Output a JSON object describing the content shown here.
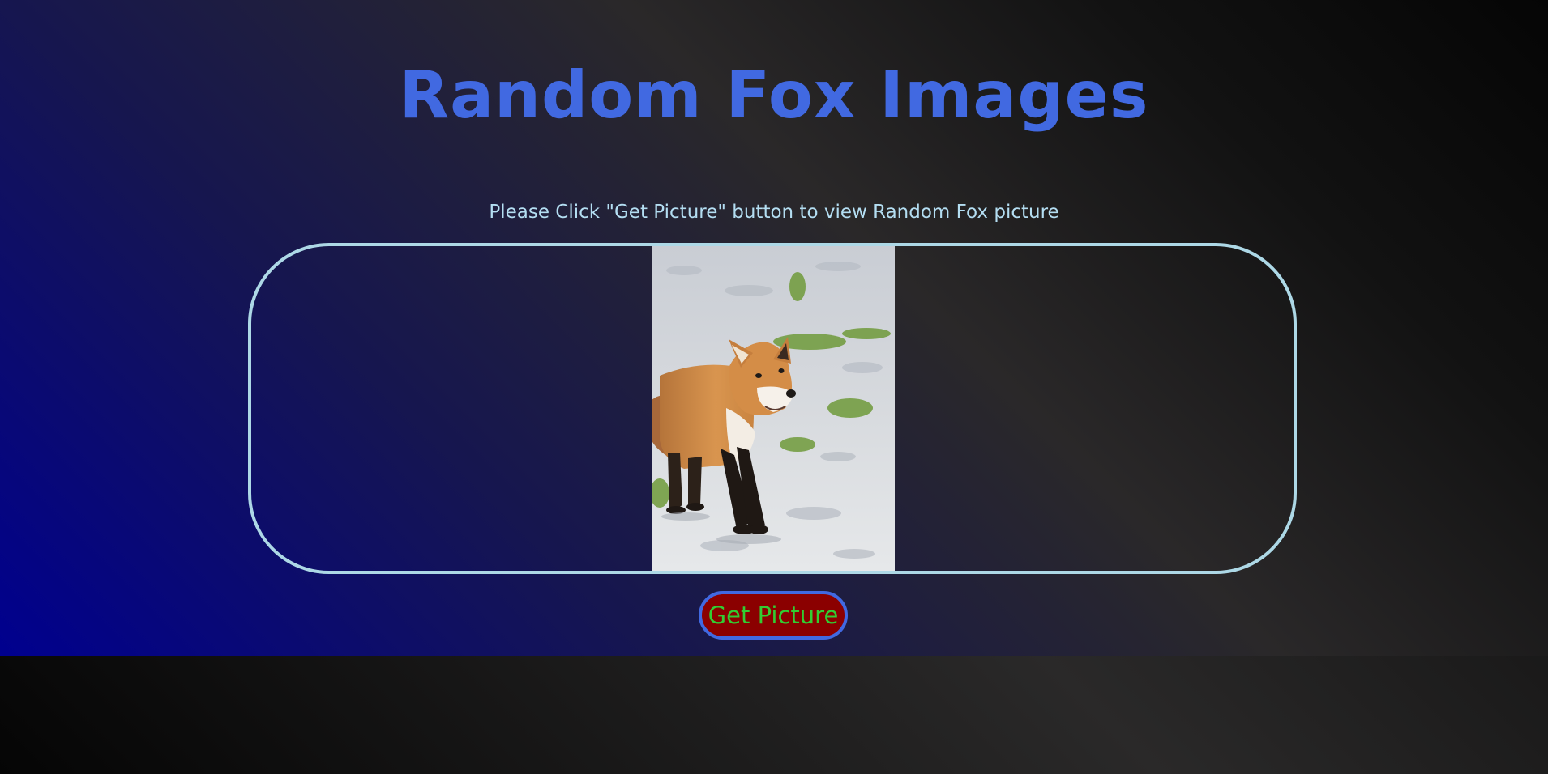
{
  "header": {
    "title": "Random Fox Images"
  },
  "main": {
    "instruction": "Please Click \"Get Picture\" button to view Random Fox picture",
    "image": {
      "subject": "fox",
      "alt": "Random Fox picture"
    },
    "button_label": "Get Picture"
  },
  "colors": {
    "title": "#4169e1",
    "instruction_text": "#b4def2",
    "frame_border": "#add8e6",
    "button_background": "#8b0000",
    "button_text": "#32cd32",
    "button_border": "#4169e1",
    "background_accent": "#00008f"
  }
}
